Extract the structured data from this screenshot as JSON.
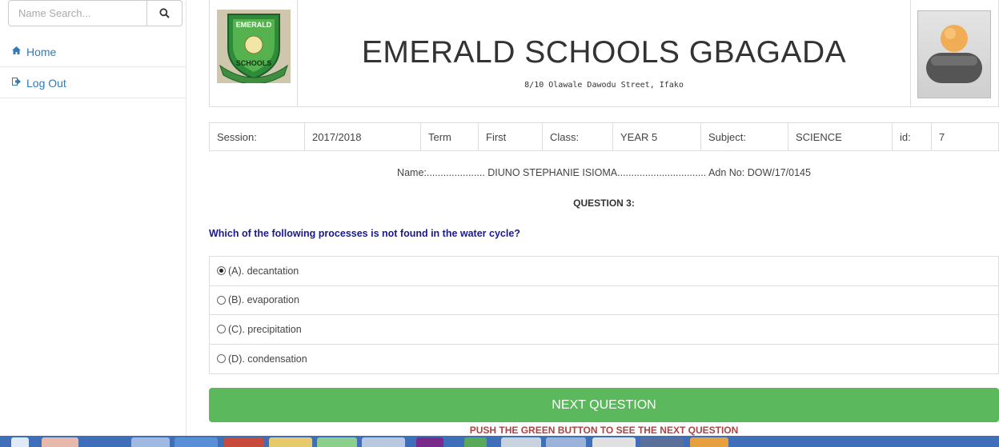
{
  "sidebar": {
    "search": {
      "placeholder": "Name Search..."
    },
    "items": [
      {
        "label": "Home",
        "icon": "home-icon"
      },
      {
        "label": "Log Out",
        "icon": "logout-icon"
      }
    ]
  },
  "header": {
    "logo_text_top": "EMERALD",
    "logo_text_bottom": "SCHOOLS",
    "school_name": "EMERALD SCHOOLS GBAGADA",
    "address": "8/10 Olawale Dawodu Street, Ifako"
  },
  "info": {
    "session_label": "Session:",
    "session_value": "2017/2018",
    "term_label": "Term",
    "term_value": "First",
    "class_label": "Class:",
    "class_value": "YEAR 5",
    "subject_label": "Subject:",
    "subject_value": "SCIENCE",
    "id_label": "id:",
    "id_value": "7"
  },
  "student": {
    "name_label": "Name:.....................",
    "name_value": "DIUNO STEPHANIE ISIOMA",
    "dots": "................................",
    "adn_label": "Adn No:",
    "adn_value": "DOW/17/0145"
  },
  "question": {
    "number": "QUESTION 3:",
    "text": "Which of the following processes is not found in the water cycle?",
    "options": [
      {
        "label": "(A). decantation",
        "selected": true
      },
      {
        "label": "(B). evaporation",
        "selected": false
      },
      {
        "label": "(C). precipitation",
        "selected": false
      },
      {
        "label": "(D). condensation",
        "selected": false
      }
    ]
  },
  "actions": {
    "next_label": "NEXT QUESTION",
    "hint": "PUSH THE GREEN BUTTON TO SEE THE NEXT QUESTION"
  },
  "colors": {
    "accent_green": "#5cb85c",
    "link_blue": "#337ab7",
    "question_blue": "#1a1a8e",
    "hint_red": "#a94442",
    "taskbar": "#3e6fb8"
  }
}
